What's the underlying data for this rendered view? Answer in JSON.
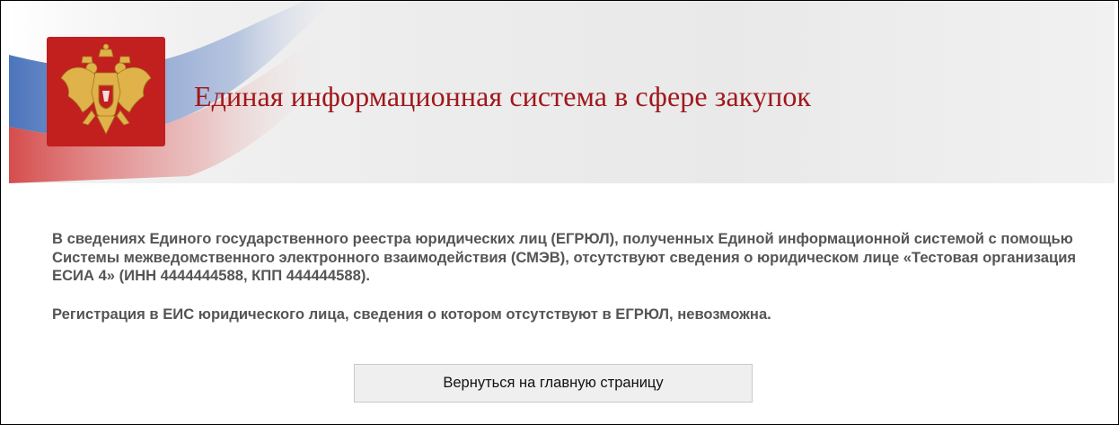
{
  "header": {
    "title": "Единая информационная система в сфере закупок",
    "emblem_icon": "russian-coat-of-arms-icon",
    "title_color": "#a0181c",
    "emblem_color": "#c21f1f"
  },
  "main": {
    "message": "В сведениях Единого государственного реестра юридических лиц (ЕГРЮЛ), полученных Единой информационной системой с помощью Системы межведомственного электронного взаимодействия (СМЭВ), отсутствуют сведения о юридическом лице «Тестовая организация ЕСИА 4» (ИНН 4444444588, КПП 444444588).",
    "notice": "Регистрация в ЕИС юридического лица, сведения о котором отсутствуют в ЕГРЮЛ, невозможна.",
    "back_button_label": "Вернуться на главную страницу"
  }
}
